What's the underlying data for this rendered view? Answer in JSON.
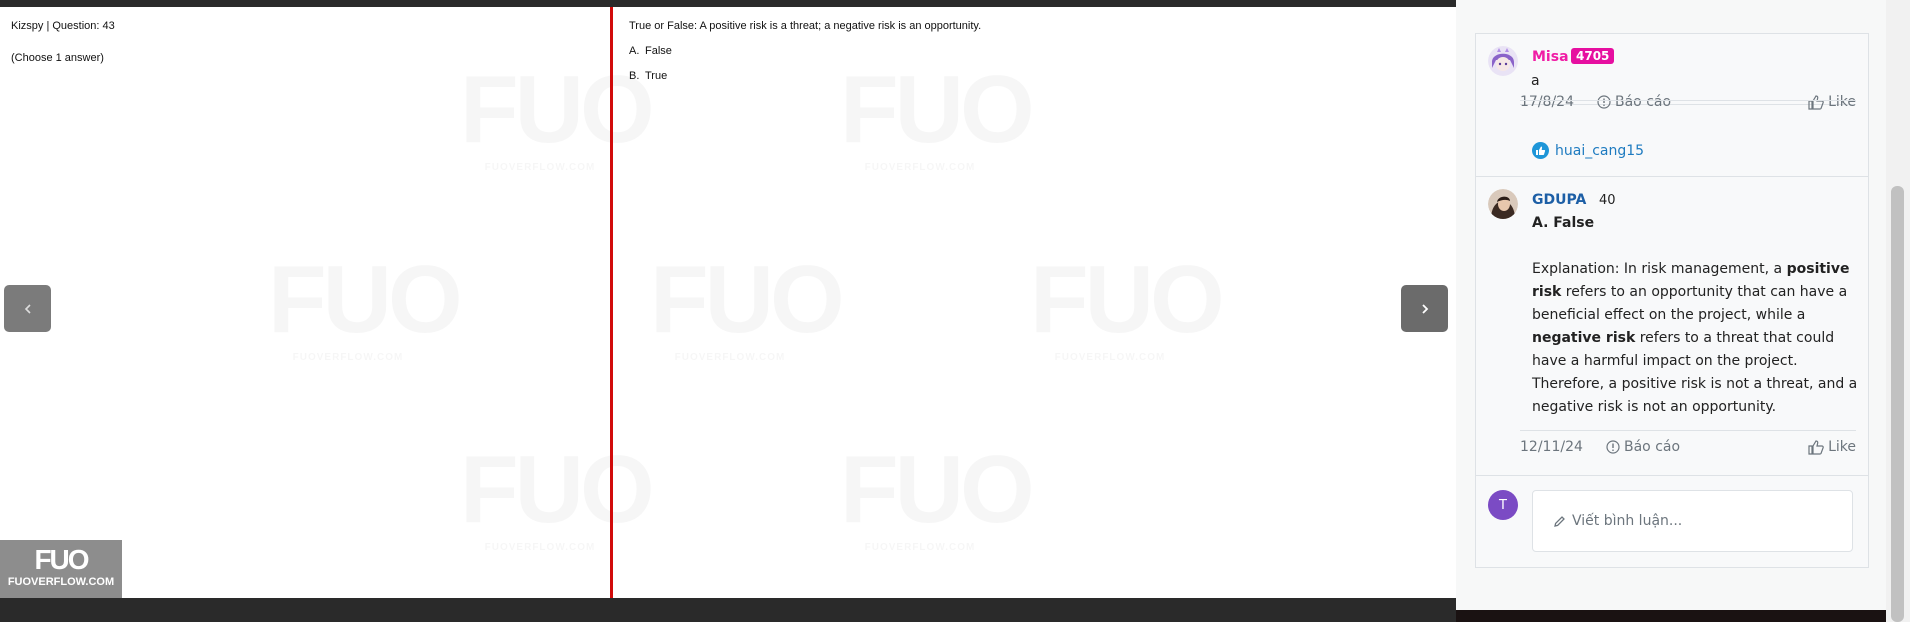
{
  "question": {
    "source": "Kizspy | Question: 43",
    "choose_hint": "(Choose 1 answer)",
    "text": "True or False: A positive risk is a threat; a negative risk is an opportunity.",
    "options": [
      {
        "letter": "A.",
        "text": "False"
      },
      {
        "letter": "B.",
        "text": "True"
      }
    ],
    "watermark": {
      "mark": "FUO",
      "domain": "FUOVERFLOW.COM"
    }
  },
  "logo": {
    "mark": "FUO",
    "domain": "FUOVERFLOW.COM"
  },
  "nav": {
    "prev_icon": "chevron-left-icon",
    "next_icon": "chevron-right-icon"
  },
  "comments": [
    {
      "author": "Misa",
      "score_badge": "4705",
      "text": "a",
      "date": "17/8/24",
      "report_label": "Báo cáo",
      "like_label": "Like",
      "liked_by": "huai_cang15"
    },
    {
      "author": "GDUPA",
      "score": "40",
      "answer": "A. False",
      "explanation_parts": {
        "p1": "Explanation: In risk management, a ",
        "b1": "positive risk",
        "p2": " refers to an opportunity that can have a beneficial effect on the project, while a ",
        "b2": "negative risk",
        "p3": " refers to a threat that could have a harmful impact on the project. Therefore, a positive risk is not a threat, and a negative risk is not an opportunity."
      },
      "date": "12/11/24",
      "report_label": "Báo cáo",
      "like_label": "Like"
    }
  ],
  "comment_input": {
    "avatar_letter": "T",
    "placeholder": "Viết bình luận..."
  },
  "colors": {
    "accent_red": "#d10a0a",
    "name_pink": "#f01da5",
    "badge_pink": "#e60fa0",
    "name_blue": "#1d5fa6",
    "link_blue": "#1e7bc0"
  }
}
